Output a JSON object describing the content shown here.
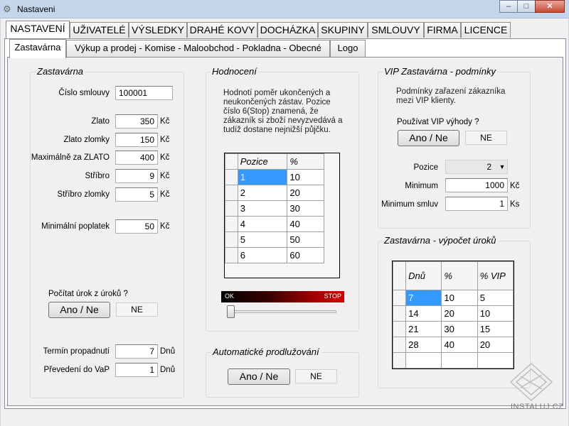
{
  "window": {
    "title": "Nastaveni",
    "minimize": "–",
    "maximize": "□",
    "close": "✕"
  },
  "tabs": [
    "NASTAVENÍ",
    "UŽIVATELÉ",
    "VÝSLEDKY",
    "DRAHÉ KOVY",
    "DOCHÁZKA",
    "SKUPINY",
    "SMLOUVY",
    "FIRMA",
    "LICENCE"
  ],
  "subtabs": [
    "Zastavárna",
    "Výkup a prodej - Komise - Maloobchod - Pokladna - Obecné",
    "Logo"
  ],
  "zastavarna": {
    "title": "Zastavárna",
    "cislo_smlouvy": {
      "label": "Číslo smlouvy",
      "value": "100001"
    },
    "fields": [
      {
        "label": "Zlato",
        "value": "350",
        "unit": "Kč"
      },
      {
        "label": "Zlato zlomky",
        "value": "150",
        "unit": "Kč"
      },
      {
        "label": "Maximálně za ZLATO",
        "value": "400",
        "unit": "Kč"
      },
      {
        "label": "Stříbro",
        "value": "9",
        "unit": "Kč"
      },
      {
        "label": "Stříbro zlomky",
        "value": "5",
        "unit": "Kč"
      }
    ],
    "min_poplatek": {
      "label": "Minimální poplatek",
      "value": "50",
      "unit": "Kč"
    },
    "pocitat_urok": {
      "label": "Počítat úrok z úroků ?",
      "button": "Ano / Ne",
      "state": "NE"
    },
    "termin": {
      "label": "Termín propadnutí",
      "value": "7",
      "unit": "Dnů"
    },
    "prevedeni": {
      "label": "Převedení do VaP",
      "value": "1",
      "unit": "Dnů"
    }
  },
  "hodnoceni": {
    "title": "Hodnocení",
    "note": "Hodnotí poměr ukončených a neukončených zástav. Pozice číslo 6(Stop) znamená, že zákazník si zboží nevyzvedává a tudíž dostane nejnižší půjčku.",
    "columns": [
      "Pozice",
      "%"
    ],
    "rows": [
      [
        "1",
        "10"
      ],
      [
        "2",
        "20"
      ],
      [
        "3",
        "30"
      ],
      [
        "4",
        "40"
      ],
      [
        "5",
        "50"
      ],
      [
        "6",
        "60"
      ]
    ],
    "gradient_start": "OK",
    "gradient_end": "STOP"
  },
  "automaticke": {
    "title": "Automatické prodlužování",
    "button": "Ano / Ne",
    "state": "NE"
  },
  "vip": {
    "title": "VIP Zastavárna - podmínky",
    "note": "Podmínky zařazení zákazníka mezi VIP klienty.",
    "question": "Používat VIP výhody ?",
    "button": "Ano / Ne",
    "state": "NE",
    "pozice": {
      "label": "Pozice",
      "value": "2"
    },
    "minimum": {
      "label": "Minimum",
      "value": "1000",
      "unit": "Kč"
    },
    "minimum_smluv": {
      "label": "Minimum smluv",
      "value": "1",
      "unit": "Ks"
    }
  },
  "vypocet": {
    "title": "Zastavárna - výpočet úroků",
    "columns": [
      "Dnů",
      "%",
      "% VIP"
    ],
    "rows": [
      [
        "7",
        "10",
        "5"
      ],
      [
        "14",
        "20",
        "10"
      ],
      [
        "21",
        "30",
        "15"
      ],
      [
        "28",
        "40",
        "20"
      ],
      [
        "",
        "",
        ""
      ]
    ]
  },
  "watermark": "INSTALUJ.CZ"
}
